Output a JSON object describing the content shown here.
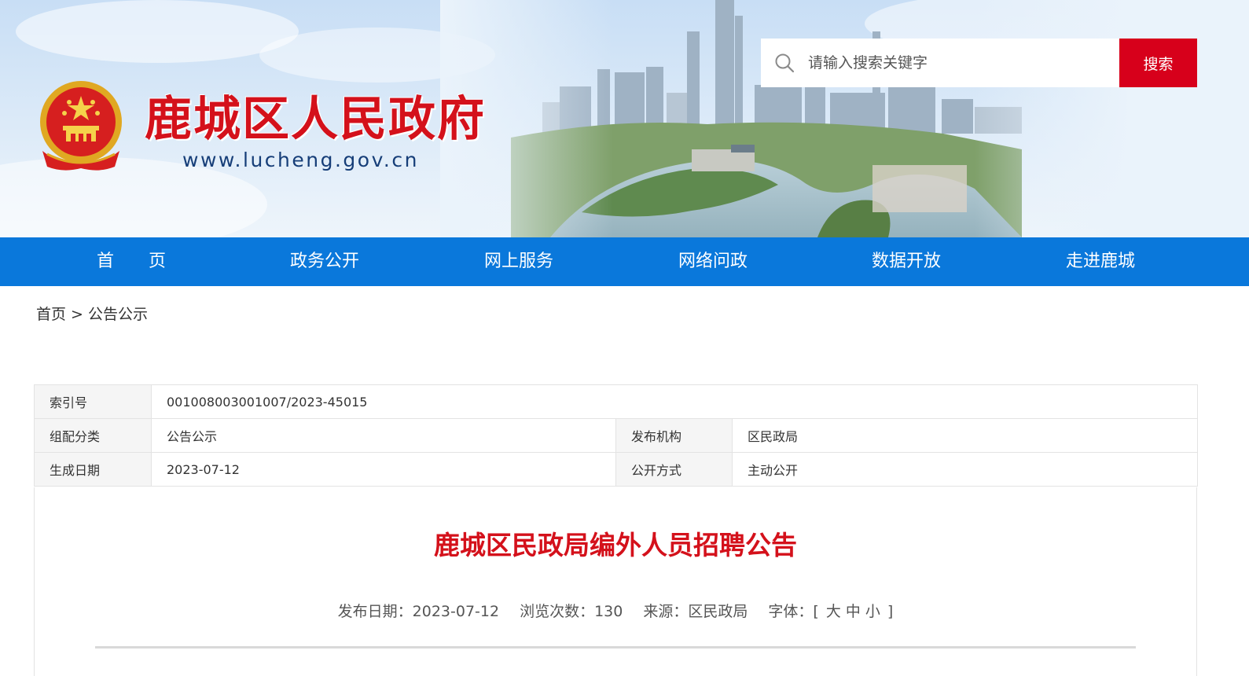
{
  "header": {
    "site_title": "鹿城区人民政府",
    "site_url": "www.lucheng.gov.cn",
    "emblem_icon": "national-emblem-icon"
  },
  "search": {
    "placeholder": "请输入搜索关键字",
    "button_label": "搜索",
    "icon": "search-icon"
  },
  "nav": {
    "items": [
      "首　　页",
      "政务公开",
      "网上服务",
      "网络问政",
      "数据开放",
      "走进鹿城"
    ]
  },
  "breadcrumb": {
    "home": "首页",
    "separator": ">",
    "current": "公告公示"
  },
  "meta": {
    "index_label": "索引号",
    "index_value": "001008003001007/2023-45015",
    "category_label": "组配分类",
    "category_value": "公告公示",
    "publisher_label": "发布机构",
    "publisher_value": "区民政局",
    "date_label": "生成日期",
    "date_value": "2023-07-12",
    "method_label": "公开方式",
    "method_value": "主动公开"
  },
  "article": {
    "title": "鹿城区民政局编外人员招聘公告",
    "publish_date": "发布日期：2023-07-12",
    "views": "浏览次数：130",
    "source": "来源：区民政局",
    "font_label": "字体：[",
    "font_large": "大",
    "font_medium": "中",
    "font_small": "小",
    "font_close": "]"
  },
  "colors": {
    "brand_red": "#d4111b",
    "nav_blue": "#0a78db",
    "search_red": "#d7001b",
    "url_blue": "#163e78"
  }
}
